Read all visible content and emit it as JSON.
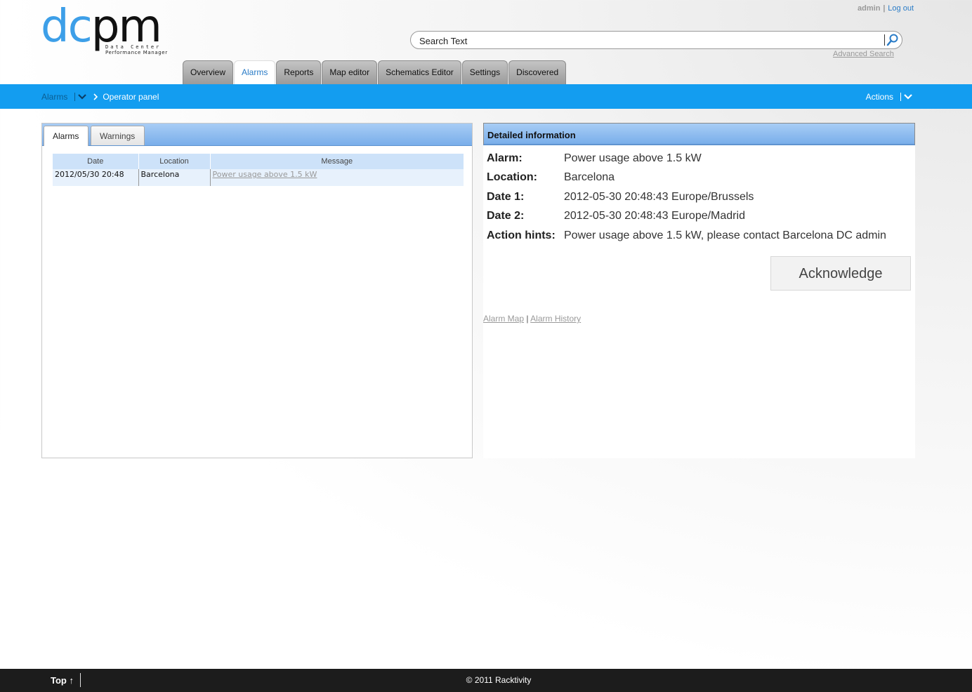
{
  "header": {
    "logo_text_dc": "dc",
    "logo_text_pm": "pm",
    "logo_subtitle_1": "Data Center",
    "logo_subtitle_2": "Performance Manager",
    "user": "admin",
    "separator": "|",
    "logout_label": "Log out",
    "search_placeholder": "Search Text",
    "advanced_search_label": "Advanced Search"
  },
  "nav": {
    "tabs": [
      {
        "label": "Overview"
      },
      {
        "label": "Alarms"
      },
      {
        "label": "Reports"
      },
      {
        "label": "Map editor"
      },
      {
        "label": "Schematics Editor"
      },
      {
        "label": "Settings"
      },
      {
        "label": "Discovered"
      }
    ],
    "active_tab": "Alarms"
  },
  "breadcrumb": {
    "parent": "Alarms",
    "current": "Operator panel",
    "actions_label": "Actions"
  },
  "alarms_panel": {
    "tabs": [
      {
        "label": "Alarms"
      },
      {
        "label": "Warnings"
      }
    ],
    "columns": [
      "Date",
      "Location",
      "Message"
    ],
    "rows": [
      {
        "date": "2012/05/30 20:48",
        "location": "Barcelona",
        "message": "Power usage above 1.5 kW"
      }
    ]
  },
  "detail": {
    "title": "Detailed information",
    "fields": [
      {
        "label": "Alarm:",
        "value": "Power usage above 1.5 kW"
      },
      {
        "label": "Location:",
        "value": "Barcelona"
      },
      {
        "label": "Date 1:",
        "value": "2012-05-30 20:48:43 Europe/Brussels"
      },
      {
        "label": "Date 2:",
        "value": "2012-05-30 20:48:43 Europe/Madrid"
      },
      {
        "label": "Action hints:",
        "value": "Power usage above 1.5 kW, please contact Barcelona DC admin"
      }
    ],
    "acknowledge_label": "Acknowledge",
    "alarm_map_label": "Alarm Map",
    "link_separator": "|",
    "alarm_history_label": "Alarm History"
  },
  "footer": {
    "top_label": "Top ↑",
    "copyright": "© 2011 Racktivity"
  },
  "colors": {
    "brand_blue": "#3d9fe8",
    "bar_blue": "#139df0",
    "footer_bg": "#1c1c1c"
  },
  "icons": [
    "search-icon",
    "chevron-down-icon",
    "chevron-right-icon",
    "arrow-up-icon"
  ]
}
